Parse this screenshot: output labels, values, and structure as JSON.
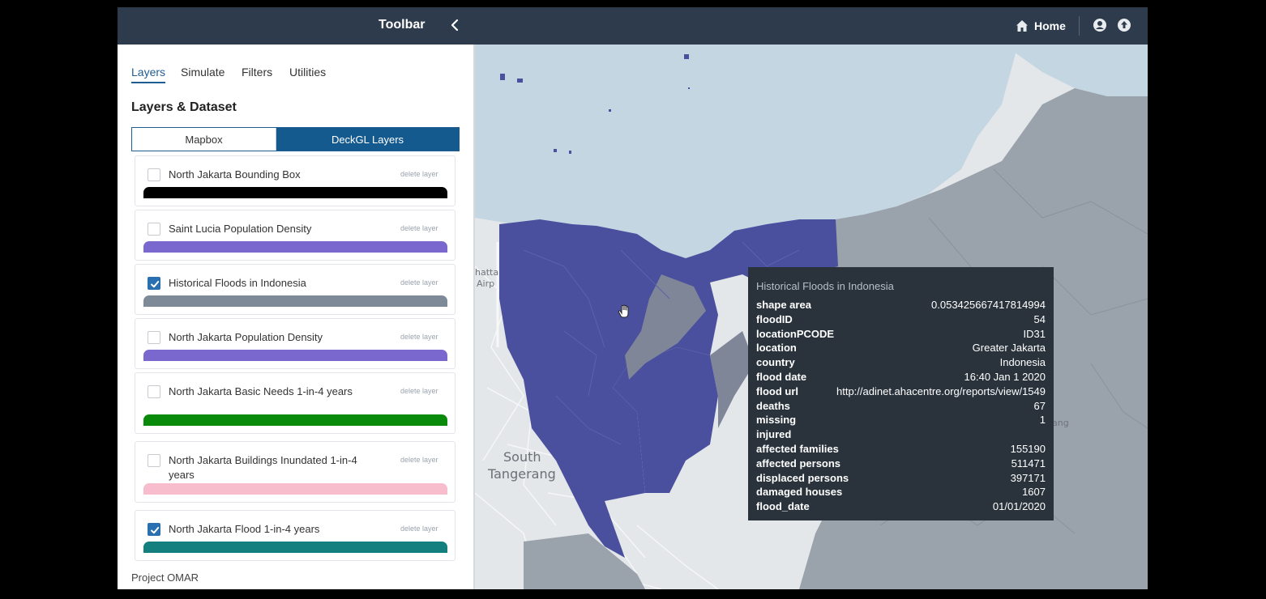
{
  "sidebar": {
    "title": "Toolbar",
    "tabs": [
      {
        "label": "Layers",
        "active": true
      },
      {
        "label": "Simulate",
        "active": false
      },
      {
        "label": "Filters",
        "active": false
      },
      {
        "label": "Utilities",
        "active": false
      }
    ],
    "section_title": "Layers & Dataset",
    "segment": {
      "mapbox": "Mapbox",
      "deckgl": "DeckGL Layers",
      "selected": "DeckGL Layers"
    },
    "delete_label": "delete layer",
    "layers": [
      {
        "name": "North Jakarta Bounding Box",
        "checked": false,
        "color": "#000000"
      },
      {
        "name": "Saint Lucia Population Density",
        "checked": false,
        "color": "#7b68cf"
      },
      {
        "name": "Historical Floods in Indonesia",
        "checked": true,
        "color": "#7e8a98"
      },
      {
        "name": "North Jakarta Population Density",
        "checked": false,
        "color": "#7b68cf"
      },
      {
        "name": "North Jakarta Basic Needs 1-in-4 years",
        "checked": false,
        "color": "#0a8a0a"
      },
      {
        "name": "North Jakarta Buildings Inundated 1-in-4 years",
        "checked": false,
        "color": "#f7bdcc"
      },
      {
        "name": "North Jakarta Flood 1-in-4 years",
        "checked": true,
        "color": "#13807f"
      }
    ],
    "footer": "Project OMAR"
  },
  "header": {
    "home_label": "Home",
    "home_icon": "home-icon",
    "user_icon": "user-icon",
    "upload_icon": "upload-icon",
    "bg_color": "#2e3b4c"
  },
  "map": {
    "labels": [
      "hatta",
      "Airp",
      "South",
      "Tangerang",
      "ang"
    ],
    "colors": {
      "water": "#c5d6e3",
      "land": "#e4e7ea",
      "district": "#9aa2ab",
      "flood": "#4a4f9e",
      "flood_grey": "#7e8698"
    }
  },
  "tooltip": {
    "title": "Historical Floods in Indonesia",
    "rows": [
      {
        "key": "shape area",
        "value": "0.053425667417814994"
      },
      {
        "key": "floodID",
        "value": "54"
      },
      {
        "key": "locationPCODE",
        "value": "ID31"
      },
      {
        "key": "location",
        "value": "Greater Jakarta"
      },
      {
        "key": "country",
        "value": "Indonesia"
      },
      {
        "key": "flood date",
        "value": "16:40 Jan 1 2020"
      },
      {
        "key": "flood url",
        "value": "http://adinet.ahacentre.org/reports/view/1549"
      },
      {
        "key": "deaths",
        "value": "67"
      },
      {
        "key": "missing",
        "value": "1"
      },
      {
        "key": "injured",
        "value": ""
      },
      {
        "key": "affected families",
        "value": "155190"
      },
      {
        "key": "affected persons",
        "value": "511471"
      },
      {
        "key": "displaced persons",
        "value": "397171"
      },
      {
        "key": "damaged houses",
        "value": "1607"
      },
      {
        "key": "flood_date",
        "value": "01/01/2020"
      }
    ]
  }
}
